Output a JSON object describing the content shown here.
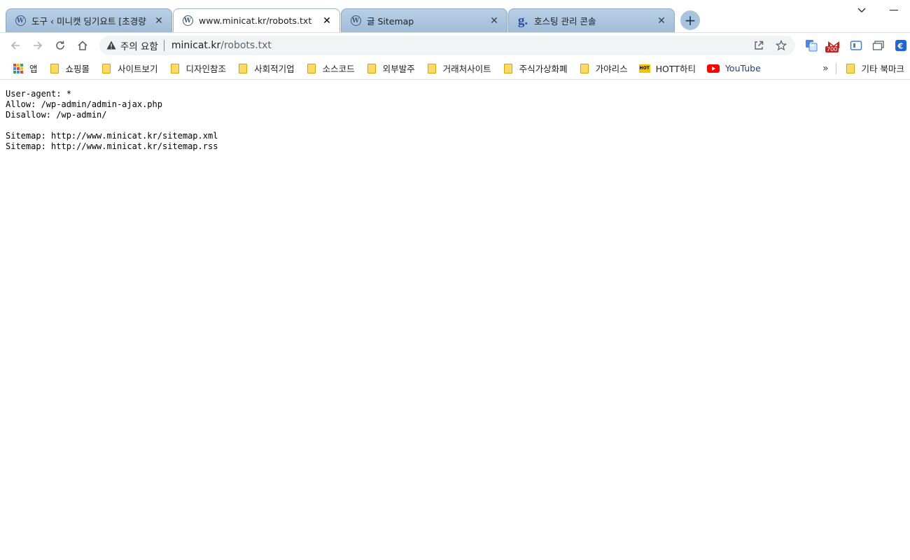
{
  "tabs": [
    {
      "title": "도구 ‹ 미니캣 딩기요트 [초경량",
      "icon": "wordpress-icon",
      "active": false
    },
    {
      "title": "www.minicat.kr/robots.txt",
      "icon": "wordpress-icon",
      "active": true
    },
    {
      "title": "글 Sitemap",
      "icon": "wordpress-icon",
      "active": false
    },
    {
      "title": "호스팅 관리 콘솔",
      "icon": "gabia-icon",
      "active": false
    }
  ],
  "toolbar": {
    "security_warning": "주의 요함",
    "url_host": "minicat.kr",
    "url_path": "/robots.txt"
  },
  "extensions": {
    "mail_badge": "700"
  },
  "bookmarks": [
    {
      "label": "앱",
      "icon": "apps-icon"
    },
    {
      "label": "쇼핑몰",
      "icon": "folder-icon"
    },
    {
      "label": "사이트보기",
      "icon": "folder-icon"
    },
    {
      "label": "디자인참조",
      "icon": "folder-icon"
    },
    {
      "label": "사회적기업",
      "icon": "folder-icon"
    },
    {
      "label": "소스코드",
      "icon": "folder-icon"
    },
    {
      "label": "외부발주",
      "icon": "folder-icon"
    },
    {
      "label": "거래처사이트",
      "icon": "folder-icon"
    },
    {
      "label": "주식가상화폐",
      "icon": "folder-icon"
    },
    {
      "label": "가야리스",
      "icon": "folder-icon"
    },
    {
      "label": "HOTT하티",
      "icon": "hott-icon"
    },
    {
      "label": "YouTube",
      "icon": "youtube-icon"
    }
  ],
  "bookmarks_more": "»",
  "other_bookmarks": "기타 북마크",
  "robots": {
    "line1": "User-agent: *",
    "line2": "Allow: /wp-admin/admin-ajax.php",
    "line3": "Disallow: /wp-admin/",
    "line4": "",
    "line5": "Sitemap: http://www.minicat.kr/sitemap.xml",
    "line6": "Sitemap: http://www.minicat.kr/sitemap.rss"
  },
  "colors": {
    "tab_inactive": "#9fbcd8",
    "youtube_red": "#ff0000",
    "folder_yellow": "#ffd966"
  }
}
